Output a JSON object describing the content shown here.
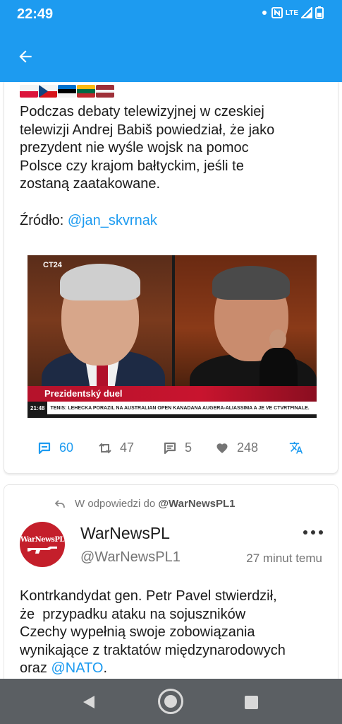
{
  "status_bar": {
    "time": "22:49",
    "network": "LTE"
  },
  "app_bar": {
    "back_icon": "arrow-left-icon"
  },
  "tweet1": {
    "flags": [
      "Poland",
      "Czech Republic",
      "Estonia",
      "Lithuania",
      "Latvia"
    ],
    "text": "Podczas debaty telewizyjnej w czeskiej\ntelewizji Andrej Babiš powiedział, że jako\nprezydent nie wyśle wojsk na pomoc\nPolsce czy krajom bałtyckim, jeśli te\nzostaną zaatakowane.\n\nŹródło: ",
    "source_mention": "@jan_skvrnak",
    "media": {
      "channel_logo": "CT24",
      "lower_third_title": "Prezidentský duel",
      "ticker_time": "21:48",
      "ticker_text": "TENIS: LEHEČKA PORAZIL NA AUSTRALIAN OPEN KANAĎANA AUGERA-ALIASSIMA A JE VE ČTVRTFINÁLE."
    },
    "actions": {
      "comments": "60",
      "retweets": "47",
      "quotes": "5",
      "likes": "248"
    }
  },
  "tweet2": {
    "reply_prefix": "W odpowiedzi do",
    "reply_to": "@WarNewsPL1",
    "avatar_text": "WarNewsPL",
    "display_name": "WarNewsPL",
    "handle": "@WarNewsPL1",
    "time_ago": "27 minut temu",
    "text": "Kontrkandydat gen. Petr Pavel stwierdził,\nże  przypadku ataku na sojuszników\nCzechy wypełnią swoje zobowiązania\nwynikające z traktatów międzynarodowych\noraz ",
    "mention": "@NATO",
    "text_end": "."
  },
  "colors": {
    "brand": "#1d9bf0",
    "nav_bar": "#5b5f63",
    "avatar_bg": "#c41f2b"
  }
}
